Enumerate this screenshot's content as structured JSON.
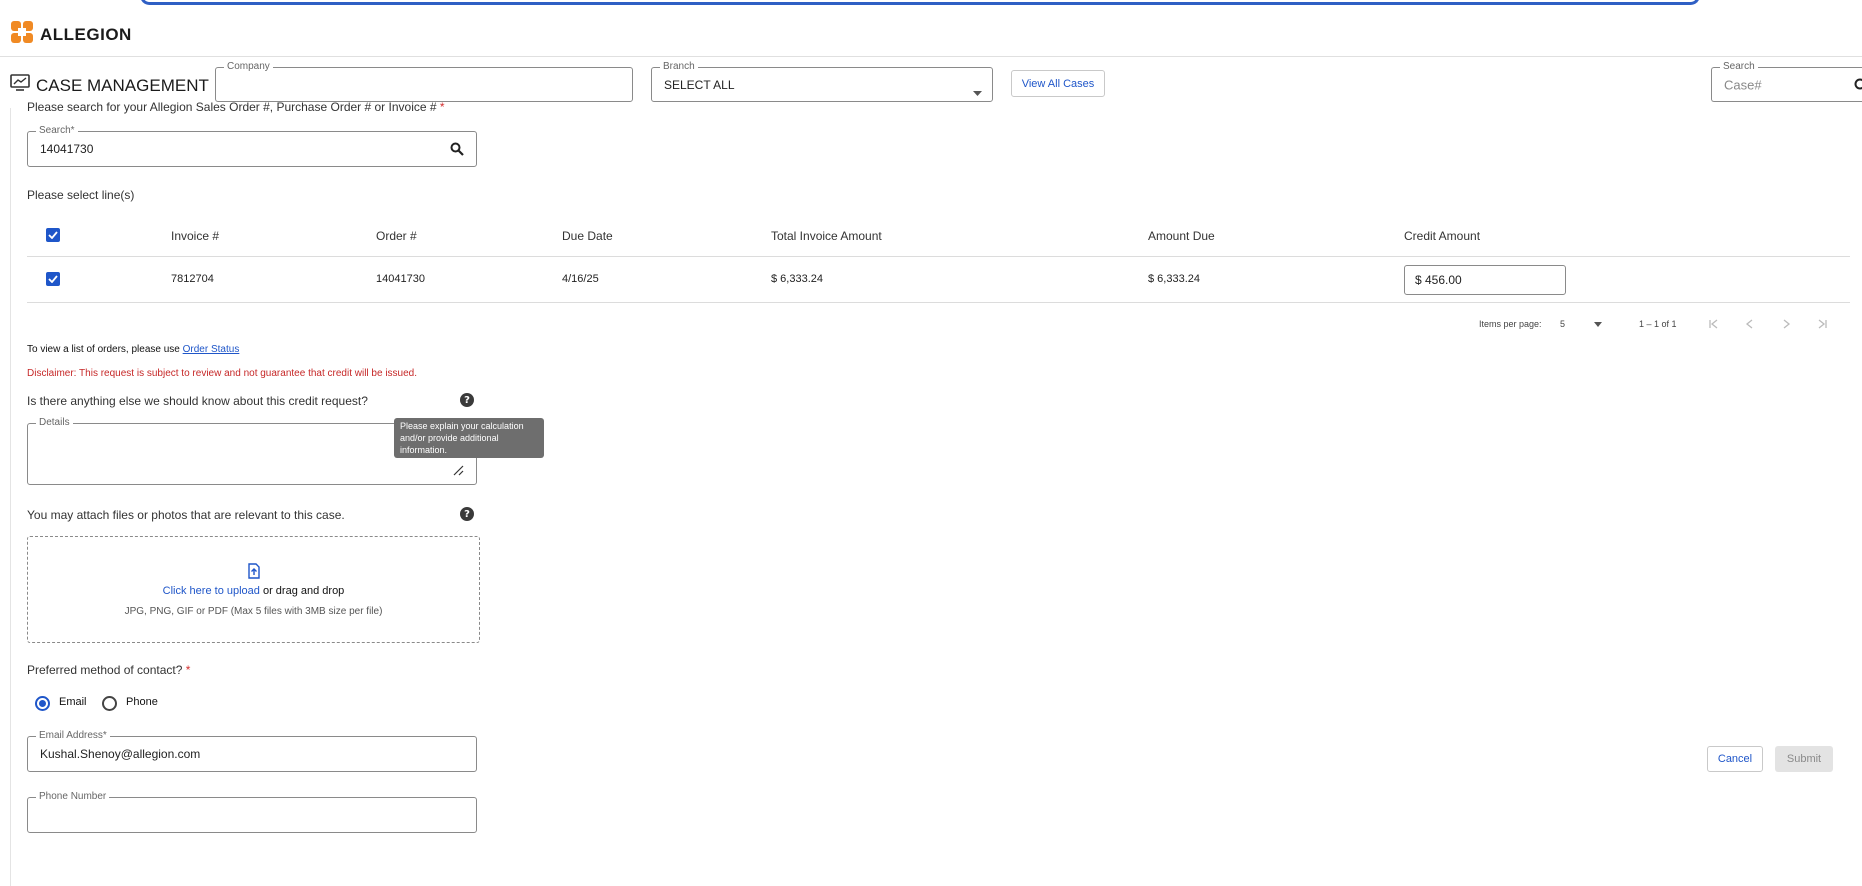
{
  "app": {
    "brand": "ALLEGION",
    "module_title": "CASE MANAGEMENT"
  },
  "filters": {
    "company_label": "Company",
    "company_value": "",
    "branch_label": "Branch",
    "branch_value": "SELECT ALL",
    "view_all_label": "View All Cases",
    "search_label": "Search",
    "search_placeholder": "Case#"
  },
  "form": {
    "search_prompt": "Please search for your Allegion Sales Order #, Purchase Order # or Invoice #",
    "required_mark": "*",
    "search_label": "Search*",
    "search_value": "14041730",
    "select_lines_label": "Please select line(s)",
    "table": {
      "columns": [
        "Invoice #",
        "Order #",
        "Due Date",
        "Total Invoice Amount",
        "Amount Due",
        "Credit Amount"
      ],
      "rows": [
        {
          "invoice": "7812704",
          "order": "14041730",
          "due_date": "4/16/25",
          "total": "$ 6,333.24",
          "amount_due": "$ 6,333.24",
          "credit": "$ 456.00",
          "checked": true
        }
      ],
      "header_checked": true
    },
    "pagination": {
      "items_per_page_label": "Items per page:",
      "items_per_page_value": "5",
      "range": "1 – 1 of 1"
    },
    "order_status_prefix": "To view a list of orders, please use",
    "order_status_link": "Order Status",
    "disclaimer": "Disclaimer: This request is subject to review and not guarantee that credit will be issued.",
    "details_question": "Is there anything else we should know about this credit request?",
    "details_label": "Details",
    "details_value": "",
    "tooltip": "Please explain your calculation and/or provide additional information.",
    "attach_prompt": "You may attach files or photos that are relevant to this case.",
    "upload_link": "Click here to upload",
    "upload_suffix": "or drag and drop",
    "upload_hint": "JPG, PNG, GIF or PDF (Max 5 files with 3MB size per file)",
    "contact_question": "Preferred method of contact?",
    "contact_options": [
      "Email",
      "Phone"
    ],
    "contact_selected": "Email",
    "email_label": "Email Address*",
    "email_value": "Kushal.Shenoy@allegion.com",
    "phone_label": "Phone Number",
    "phone_value": "",
    "cancel_label": "Cancel",
    "submit_label": "Submit"
  },
  "colors": {
    "accent": "#1f56c9",
    "brand_orange": "#f08a24",
    "required_red": "#d32f2f",
    "disabled_gray": "#e3e3e3"
  },
  "icons": [
    "allegion-logo-icon",
    "chart-monitor-icon",
    "chevron-down-icon",
    "search-icon",
    "check-icon",
    "help-icon",
    "resize-handle-icon",
    "upload-file-icon",
    "first-page-icon",
    "prev-page-icon",
    "next-page-icon",
    "last-page-icon"
  ]
}
